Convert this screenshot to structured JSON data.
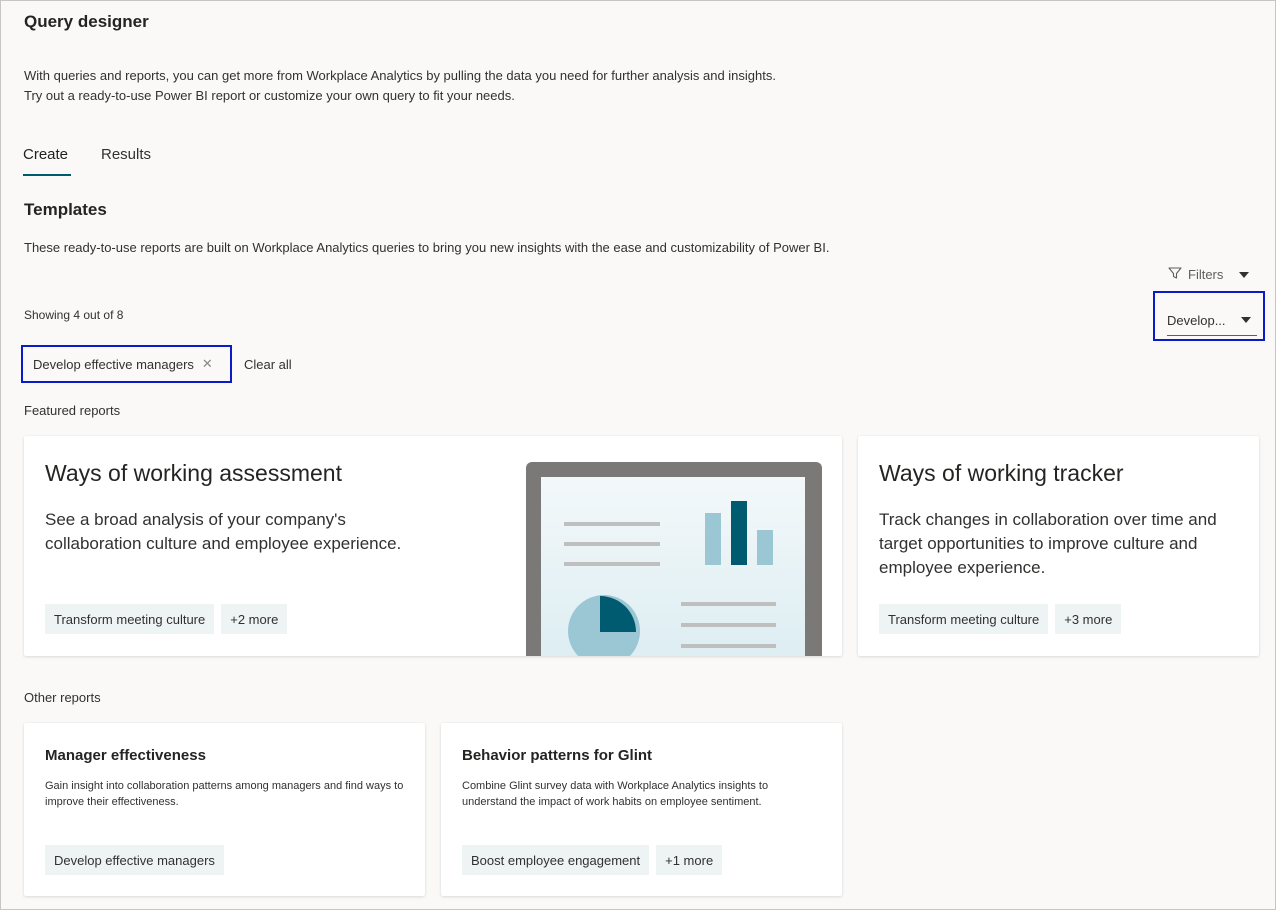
{
  "header": {
    "title": "Query designer",
    "description_line1": "With queries and reports, you can get more from Workplace Analytics by pulling the data you need for further analysis and insights.",
    "description_line2": "Try out a ready-to-use Power BI report or customize your own query to fit your needs."
  },
  "tabs": [
    {
      "label": "Create",
      "active": true
    },
    {
      "label": "Results",
      "active": false
    }
  ],
  "templates": {
    "title": "Templates",
    "description": "These ready-to-use reports are built on Workplace Analytics queries to bring you new insights with the ease and customizability of Power BI.",
    "showing": "Showing 4 out of 8",
    "filters_label": "Filters",
    "filter_dropdown_value": "Develop...",
    "active_filter": "Develop effective managers",
    "clear_all": "Clear all"
  },
  "featured": {
    "label": "Featured reports",
    "cards": [
      {
        "title": "Ways of working assessment",
        "body": "See a broad analysis of your company's collaboration culture and employee experience.",
        "tags": [
          "Transform meeting culture",
          "+2 more"
        ]
      },
      {
        "title": "Ways of working tracker",
        "body": "Track changes in collaboration over time and target opportunities to improve culture and employee experience.",
        "tags": [
          "Transform meeting culture",
          "+3 more"
        ]
      }
    ]
  },
  "other": {
    "label": "Other reports",
    "cards": [
      {
        "title": "Manager effectiveness",
        "body": "Gain insight into collaboration patterns among managers and find ways to improve their effectiveness.",
        "tags": [
          "Develop effective managers"
        ]
      },
      {
        "title": "Behavior patterns for Glint",
        "body": "Combine Glint survey data with Workplace Analytics insights to understand the impact of work habits on employee sentiment.",
        "tags": [
          "Boost employee engagement",
          "+1 more"
        ]
      }
    ]
  },
  "colors": {
    "accent": "#005b70",
    "highlight_border": "#0a1bc9",
    "tag_bg": "#eef3f4",
    "page_bg": "#faf9f8"
  },
  "icons": [
    "filter-icon",
    "chevron-down-icon",
    "close-icon"
  ]
}
